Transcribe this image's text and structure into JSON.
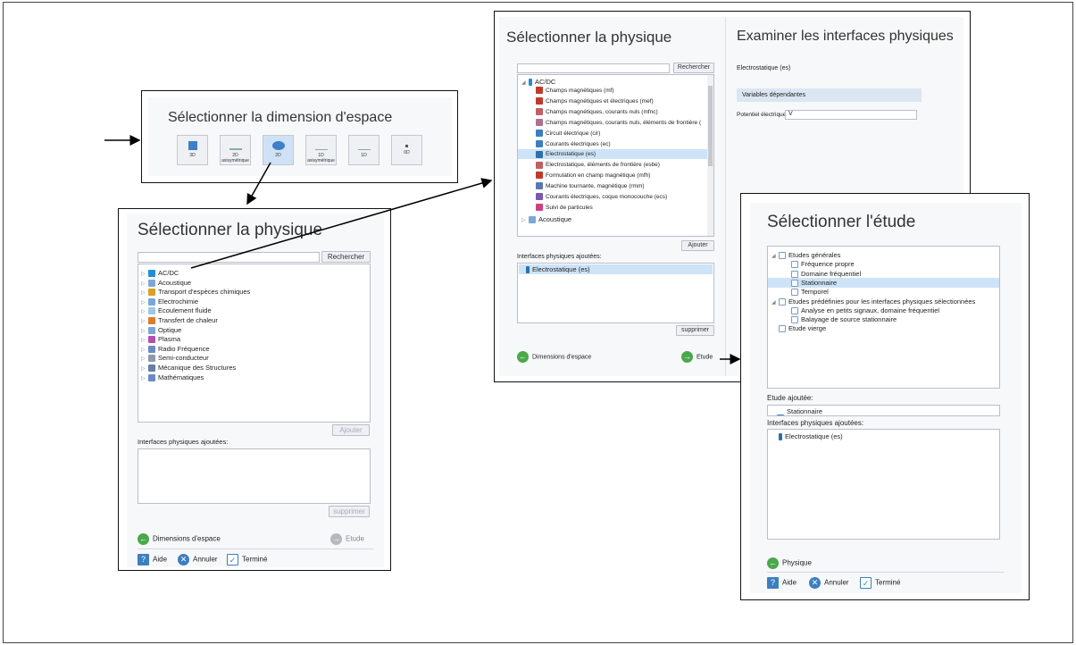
{
  "dimension": {
    "title": "Sélectionner la dimension d'espace",
    "buttons": [
      {
        "label": "3D"
      },
      {
        "label": "2D axisymétrique"
      },
      {
        "label": "2D"
      },
      {
        "label": "1D axisymétrique"
      },
      {
        "label": "1D"
      },
      {
        "label": "0D"
      }
    ]
  },
  "physics1": {
    "title": "Sélectionner la physique",
    "search_button": "Rechercher",
    "tree": [
      {
        "label": "AC/DC",
        "color": "#1f8fd6"
      },
      {
        "label": "Acoustique",
        "color": "#7fa6d9"
      },
      {
        "label": "Transport d'espèces chimiques",
        "color": "#d9a126"
      },
      {
        "label": "Electrochimie",
        "color": "#7aa7d8"
      },
      {
        "label": "Ecoulement fluide",
        "color": "#9fc7e6"
      },
      {
        "label": "Transfert de chaleur",
        "color": "#e07b2a"
      },
      {
        "label": "Optique",
        "color": "#7aa7d8"
      },
      {
        "label": "Plasma",
        "color": "#b44fb1"
      },
      {
        "label": "Radio Fréquence",
        "color": "#6c8cc0"
      },
      {
        "label": "Semi-conducteur",
        "color": "#8d9aa8"
      },
      {
        "label": "Mécanique des Structures",
        "color": "#6a7fa8"
      },
      {
        "label": "Mathématiques",
        "color": "#6c8cc0"
      }
    ],
    "add_button": "Ajouter",
    "added_label": "Interfaces physiques ajoutées:",
    "remove_button": "supprimer",
    "nav_back": "Dimensions d'espace",
    "nav_next": "Etude",
    "help": "Aide",
    "cancel": "Annuler",
    "done": "Terminé"
  },
  "physics2": {
    "title": "Sélectionner la physique",
    "search_button": "Rechercher",
    "tree_root": "AC/DC",
    "tree": [
      {
        "label": "Champs magnétiques (mf)",
        "color": "#c0392b"
      },
      {
        "label": "Champs magnétiques et électriques (mef)",
        "color": "#c0392b"
      },
      {
        "label": "Champs magnétiques, courants nuls (mfnc)",
        "color": "#c06060"
      },
      {
        "label": "Champs magnétiques, courants nuls, éléments de frontière (",
        "color": "#b07090"
      },
      {
        "label": "Circuit électrique (cir)",
        "color": "#3c7fc0"
      },
      {
        "label": "Courants électriques (ec)",
        "color": "#3c7fc0"
      },
      {
        "label": "Electrostatique (es)",
        "color": "#2c6fb0"
      },
      {
        "label": "Electrostatique, éléments de frontière (esbe)",
        "color": "#c06060"
      },
      {
        "label": "Formulation en champ magnétique (mfh)",
        "color": "#c0392b"
      },
      {
        "label": "Machine tournante, magnétique (rmm)",
        "color": "#5a78b0"
      },
      {
        "label": "Courants électriques, coque monocouche (ecs)",
        "color": "#7a5ab0"
      },
      {
        "label": "Suivi de particules",
        "color": "#d04080"
      }
    ],
    "tree_after": "Acoustique",
    "add_button": "Ajouter",
    "added_label": "Interfaces physiques ajoutées:",
    "added_item": "Electrostatique (es)",
    "remove_button": "supprimer",
    "nav_back": "Dimensions d'espace",
    "nav_next": "Etude",
    "review_title": "Examiner les interfaces physiques",
    "review_interface": "Electrostatique (es)",
    "review_header": "Variables dépendantes",
    "potential_label": "Potentiel électrique:",
    "potential_value": "V"
  },
  "study": {
    "title": "Sélectionner l'étude",
    "tree": [
      {
        "label": "Etudes générales",
        "level": 0
      },
      {
        "label": "Fréquence propre",
        "level": 1
      },
      {
        "label": "Domaine fréquentiel",
        "level": 1
      },
      {
        "label": "Stationnaire",
        "level": 1
      },
      {
        "label": "Temporel",
        "level": 1
      },
      {
        "label": "Etudes prédéfinies pour les interfaces physiques sélectionnées",
        "level": 0
      },
      {
        "label": "Analyse en petits signaux, domaine fréquentiel",
        "level": 1
      },
      {
        "label": "Balayage de source stationnaire",
        "level": 1
      },
      {
        "label": "Etude vierge",
        "level": 0
      }
    ],
    "added_study_label": "Etude ajoutée:",
    "added_study": "Stationnaire",
    "added_label": "Interfaces physiques ajoutées:",
    "added_item": "Electrostatique (es)",
    "nav_back": "Physique",
    "help": "Aide",
    "cancel": "Annuler",
    "done": "Terminé"
  }
}
